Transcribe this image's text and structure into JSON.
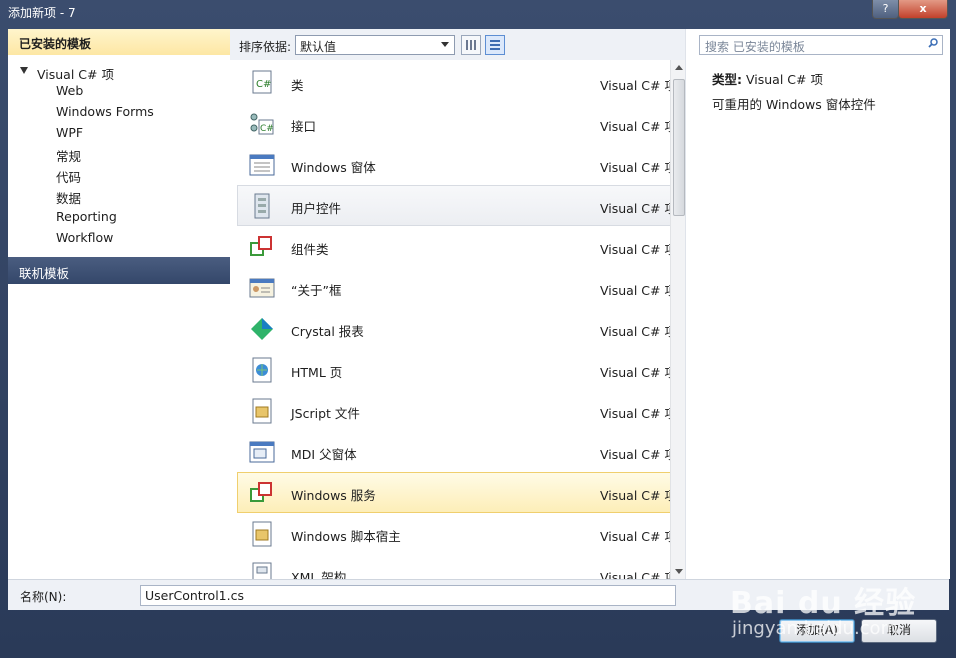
{
  "window": {
    "title": "添加新项 - 7",
    "help_glyph": "?",
    "close_glyph": "x"
  },
  "left": {
    "header": "已安装的模板",
    "root": "Visual C# 项",
    "items": [
      "Web",
      "Windows Forms",
      "WPF",
      "常规",
      "代码",
      "数据",
      "Reporting",
      "Workflow"
    ],
    "online": "联机模板"
  },
  "toolbar": {
    "sort_label": "排序依据:",
    "sort_value": "默认值"
  },
  "list": {
    "items": [
      {
        "name": "类",
        "type": "Visual C# 项",
        "icon": "class-icon"
      },
      {
        "name": "接口",
        "type": "Visual C# 项",
        "icon": "interface-icon"
      },
      {
        "name": "Windows 窗体",
        "type": "Visual C# 项",
        "icon": "form-icon"
      },
      {
        "name": "用户控件",
        "type": "Visual C# 项",
        "icon": "user-control-icon"
      },
      {
        "name": "组件类",
        "type": "Visual C# 项",
        "icon": "component-icon"
      },
      {
        "name": "“关于”框",
        "type": "Visual C# 项",
        "icon": "about-box-icon"
      },
      {
        "name": "Crystal 报表",
        "type": "Visual C# 项",
        "icon": "crystal-report-icon"
      },
      {
        "name": "HTML 页",
        "type": "Visual C# 项",
        "icon": "html-page-icon"
      },
      {
        "name": "JScript 文件",
        "type": "Visual C# 项",
        "icon": "jscript-icon"
      },
      {
        "name": "MDI 父窗体",
        "type": "Visual C# 项",
        "icon": "mdi-form-icon"
      },
      {
        "name": "Windows 服务",
        "type": "Visual C# 项",
        "icon": "service-icon"
      },
      {
        "name": "Windows 脚本宿主",
        "type": "Visual C# 项",
        "icon": "script-host-icon"
      },
      {
        "name": "XML 架构",
        "type": "Visual C# 项",
        "icon": "xml-schema-icon"
      }
    ]
  },
  "search": {
    "placeholder": "搜索 已安装的模板"
  },
  "info": {
    "type_label": "类型:",
    "type_value": "Visual C# 项",
    "description": "可重用的 Windows 窗体控件"
  },
  "name": {
    "label": "名称(N):",
    "value": "UserControl1.cs"
  },
  "buttons": {
    "add": "添加(A)",
    "cancel": "取消"
  },
  "watermark": {
    "logo": "Bai du 经验",
    "url": "jingyan.baidu.com"
  },
  "colors": {
    "selected": "#fdeeb8",
    "header": "#fde7a4",
    "online": "#3c4f73"
  }
}
